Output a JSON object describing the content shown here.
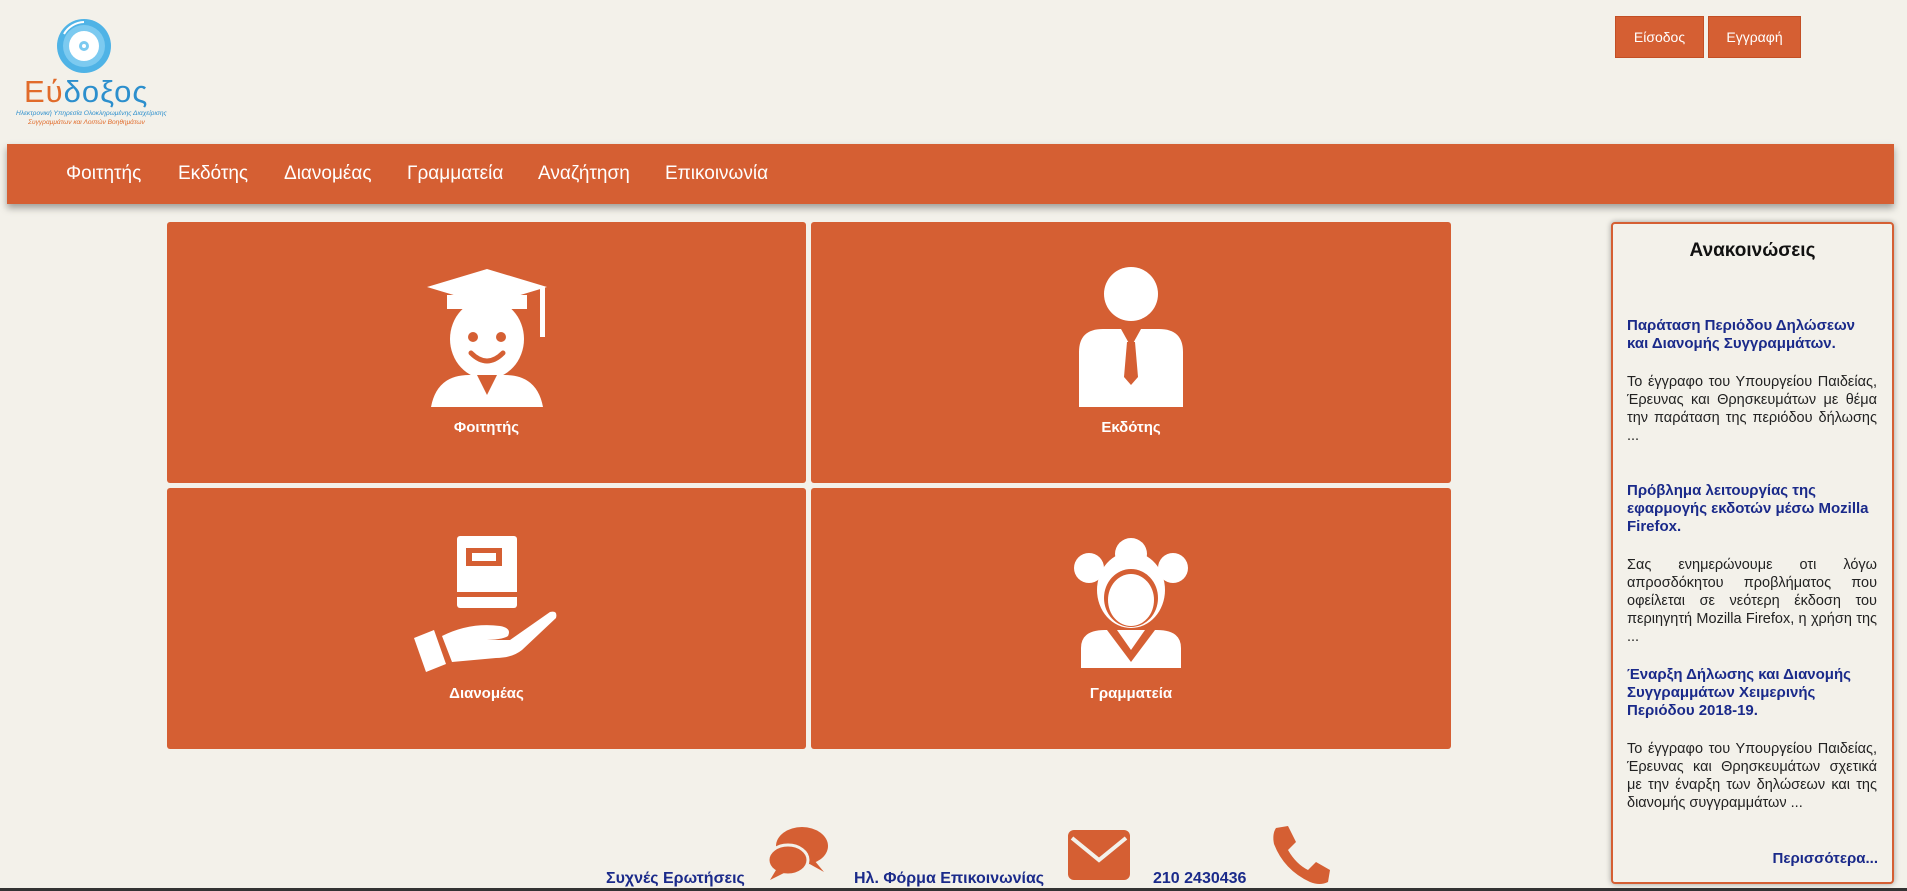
{
  "logo": {
    "word_accent": "Εύ",
    "word_rest": "δοξος",
    "subtitle_line1": "Ηλεκτρονική Υπηρεσία Ολοκληρωμένης Διαχείρισης",
    "subtitle_line2": "Συγγραμμάτων και Λοιπών Βοηθημάτων"
  },
  "header": {
    "login_label": "Είσοδος",
    "register_label": "Εγγραφή"
  },
  "nav": {
    "items": [
      "Φοιτητής",
      "Εκδότης",
      "Διανομέας",
      "Γραμματεία",
      "Αναζήτηση",
      "Επικοινωνία"
    ]
  },
  "tiles": [
    {
      "label": "Φοιτητής",
      "icon": "student-icon"
    },
    {
      "label": "Εκδότης",
      "icon": "publisher-icon"
    },
    {
      "label": "Διανομέας",
      "icon": "distributor-icon"
    },
    {
      "label": "Γραμματεία",
      "icon": "secretariat-icon"
    }
  ],
  "contact": {
    "faq_label": "Συχνές Ερωτήσεις",
    "form_label": "Ηλ. Φόρμα Επικοινωνίας",
    "phone": "210 2430436"
  },
  "announcements": {
    "title": "Ανακοινώσεις",
    "items": [
      {
        "headline": "Παράταση Περιόδου Δηλώσεων και Διανομής Συγγραμμάτων.",
        "body": "Το έγγραφο του Υπουργείου Παιδείας, Έρευνας και Θρησκευμάτων με θέμα την παράταση της περιόδου δήλωσης ..."
      },
      {
        "headline": "Πρόβλημα λειτουργίας της εφαρμογής εκδοτών μέσω Mozilla Firefox.",
        "body": "Σας ενημερώνουμε οτι λόγω απροσδόκητου προβλήματος που οφείλεται σε νεότερη έκδοση του περιηγητή Mozilla Firefox, η χρήση της ..."
      },
      {
        "headline": "Έναρξη Δήλωσης και Διανομής Συγγραμμάτων Χειμερινής Περιόδου 2018-19.",
        "body": "Το έγγραφο του Υπουργείου Παιδείας, Έρευνας και Θρησκευμάτων σχετικά με την έναρξη των δηλώσεων και της διανομής συγγραμμάτων ..."
      }
    ],
    "more_label": "Περισσότερα..."
  },
  "colors": {
    "brand_orange": "#d55f33",
    "link_blue": "#1a2a8a",
    "background": "#f3f1ea"
  }
}
